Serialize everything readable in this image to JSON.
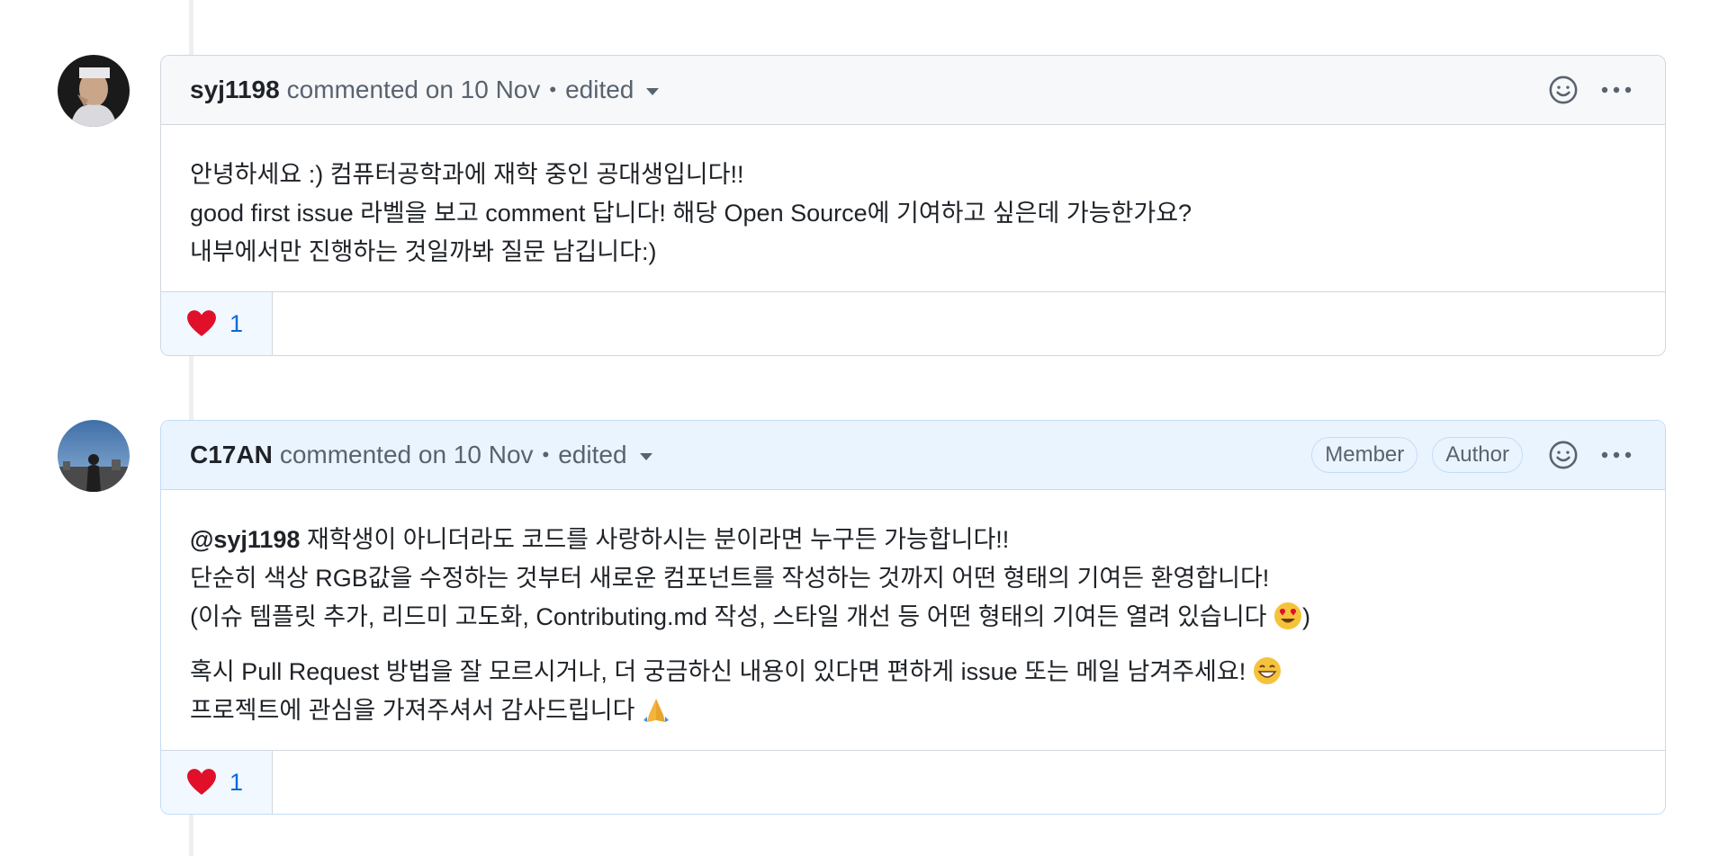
{
  "comments": [
    {
      "username": "syj1198",
      "meta": "commented on 10 Nov",
      "separator": "•",
      "edited": "edited",
      "labels": [],
      "body": [
        "안녕하세요 :) 컴퓨터공학과에 재학 중인 공대생입니다!!",
        "good first issue 라벨을 보고 comment 답니다! 해당 Open Source에 기여하고 싶은데 가능한가요?",
        "내부에서만 진행하는 것일까봐 질문 남깁니다:)"
      ],
      "reaction": {
        "emoji": "heart-icon",
        "count": "1"
      }
    },
    {
      "username": "C17AN",
      "meta": "commented on 10 Nov",
      "separator": "•",
      "edited": "edited",
      "labels": [
        "Member",
        "Author"
      ],
      "body": {
        "mention": "@syj1198",
        "line1_rest": " 재학생이 아니더라도 코드를 사랑하시는 분이라면 누구든 가능합니다!!",
        "line2": "단순히 색상 RGB값을 수정하는 것부터 새로운 컴포넌트를 작성하는 것까지 어떤 형태의 기여든 환영합니다!",
        "line3_pre": "(이슈 템플릿 추가, 리드미 고도화, Contributing.md 작성, 스타일 개선 등 어떤 형태의 기여든 열려 있습니다 ",
        "line3_post": ")",
        "line4": "혹시 Pull Request 방법을 잘 모르시거나, 더 궁금하신 내용이 있다면 편하게 issue 또는 메일 남겨주세요! ",
        "line5": "프로젝트에 관심을 가져주셔서 감사드립니다 "
      },
      "reaction": {
        "emoji": "heart-icon",
        "count": "1"
      }
    }
  ],
  "icons": {
    "smiley": "smiley-icon",
    "kebab": "kebab-horizontal-icon",
    "heart_eyes": "heart-eyes-emoji-icon",
    "grin": "grinning-emoji-icon",
    "pray": "folded-hands-emoji-icon"
  },
  "colors": {
    "link": "#0969da",
    "author_header": "#eaf4fe",
    "border": "#d0d7de"
  }
}
